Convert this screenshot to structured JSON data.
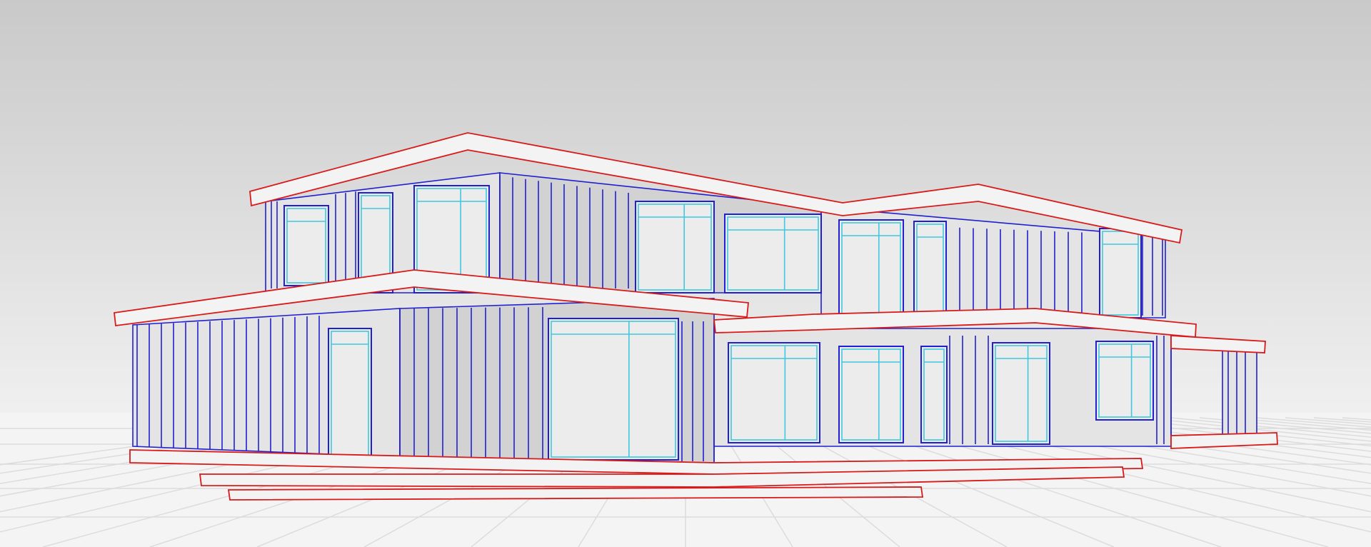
{
  "scene": {
    "subject": "house-wireframe-render",
    "colors": {
      "sky_top": "#c9c9c9",
      "sky_bottom": "#f1f1f1",
      "ground": "#f4f4f4",
      "grid": "#dcdcdc",
      "wall": "#e4e4e4",
      "wall_shade": "#d2d2d2",
      "glass": "#ececec",
      "slab_edge": "#d81a1a",
      "panel_line": "#2020d0",
      "window_line": "#3fc8e0"
    }
  }
}
